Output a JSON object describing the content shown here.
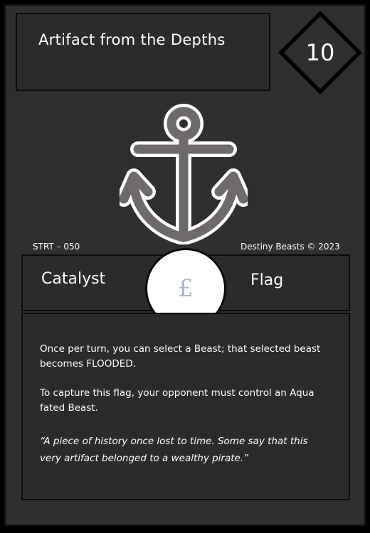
{
  "card": {
    "name": "Artifact from the Depths",
    "cost": "10",
    "art_icon": "anchor-icon",
    "set_code": "STRT – 050",
    "copyright": "Destiny Beasts © 2023",
    "type_left": "Catalyst",
    "type_right": "Flag",
    "element_icon": "pound-sign-icon",
    "element_glyph": "£",
    "effects": [
      "Once per turn, you can select a Beast; that selected beast becomes FLOODED.",
      "To capture this flag, your opponent must control an Aqua fated Beast."
    ],
    "flavor": "“A piece of history once lost to time. Some say that this very artifact belonged to a wealthy pirate.”"
  },
  "colors": {
    "background": "#2f2f2f",
    "border": "#000000",
    "text": "#ffffff",
    "anchor_fill": "#6e6a6a",
    "anchor_outline": "#ffffff",
    "element_glyph": "#a9b8cc"
  }
}
